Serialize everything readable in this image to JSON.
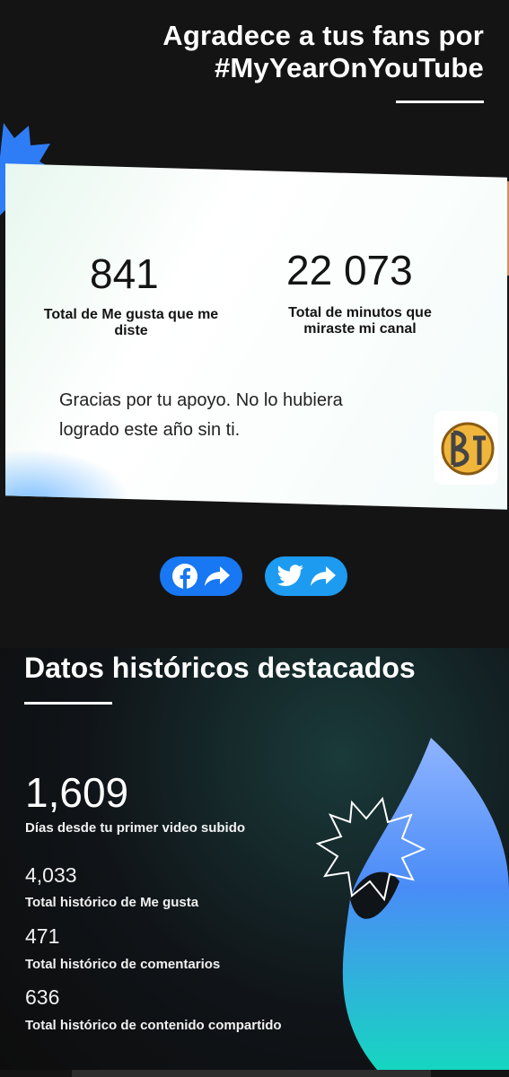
{
  "header": {
    "title_line1": "Agradece a tus fans por",
    "title_line2": "#MyYearOnYouTube"
  },
  "card": {
    "likes_given": "841",
    "likes_given_label": "Total de Me gusta que me diste",
    "minutes_watched": "22 073",
    "minutes_watched_label": "Total de minutos que miraste mi canal",
    "thanks_line1": "Gracias por tu apoyo. No lo hubiera",
    "thanks_line2": "logrado este año sin ti."
  },
  "share": {
    "facebook_icon": "facebook-icon",
    "twitter_icon": "twitter-icon",
    "share_icon": "share-arrow-icon",
    "facebook_color": "#1877f2",
    "twitter_color": "#1d9bf0"
  },
  "history": {
    "title": "Datos históricos destacados",
    "days_value": "1,609",
    "days_label": "Días desde tu primer video subido",
    "likes_value": "4,033",
    "likes_label": "Total histórico de Me gusta",
    "comments_value": "471",
    "comments_label": "Total histórico de comentarios",
    "shares_value": "636",
    "shares_label": "Total histórico de contenido compartido"
  }
}
